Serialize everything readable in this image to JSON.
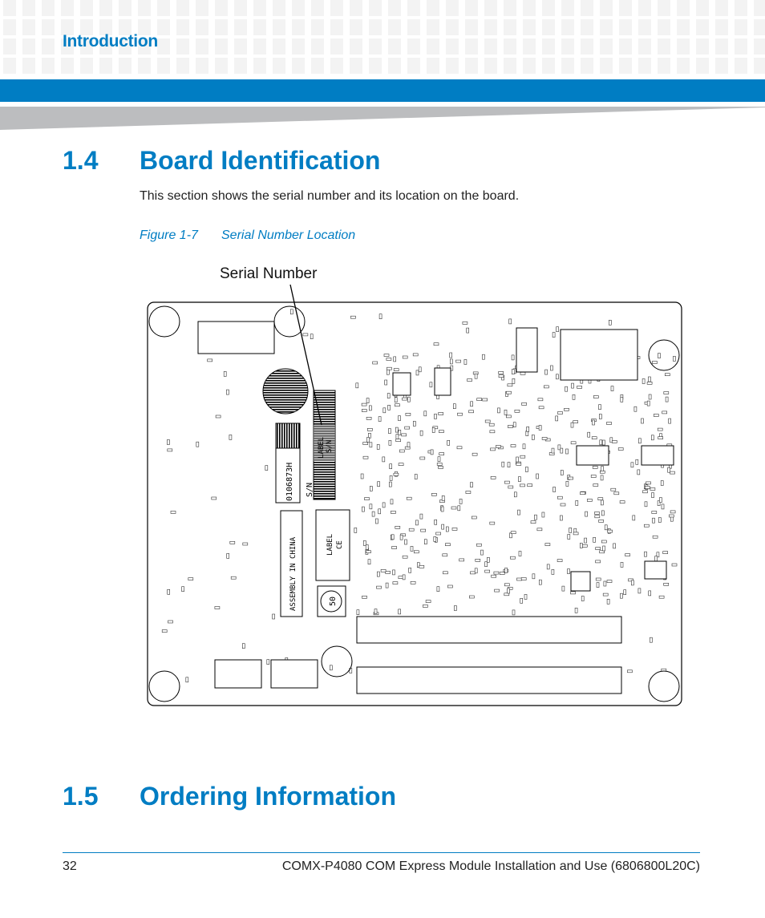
{
  "header": {
    "section": "Introduction",
    "brand_color": "#007dc3"
  },
  "sections": [
    {
      "number": "1.4",
      "title": "Board Identification"
    },
    {
      "number": "1.5",
      "title": "Ordering Information"
    }
  ],
  "intro_text": "This section shows the serial number and its location on the board.",
  "figure": {
    "label": "Figure 1-7",
    "caption": "Serial Number Location",
    "callout": "Serial Number",
    "board_labels": {
      "part_number": "0106873H",
      "sn_marker": "S/N",
      "label_sn_1": "LABEL",
      "label_sn_2": "S/N",
      "assembly": "ASSEMBLY IN CHINA",
      "label_ce_1": "LABEL",
      "label_ce_2": "CE",
      "stamp": "50"
    }
  },
  "footer": {
    "page_number": "32",
    "doc_title": "COMX-P4080 COM Express Module Installation and Use (6806800L20C)"
  }
}
